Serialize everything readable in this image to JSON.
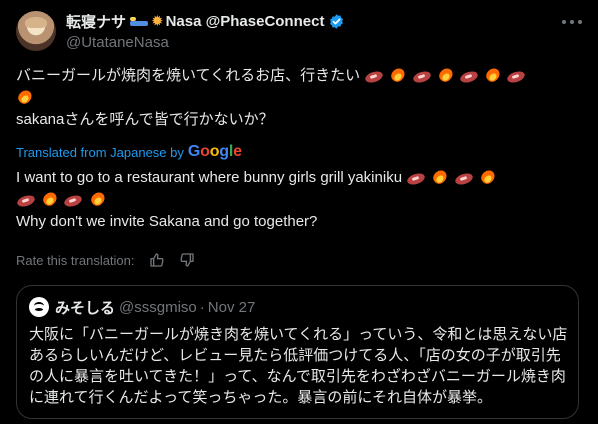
{
  "author": {
    "display_name": "転寝ナサ",
    "display_name_suffix": "Nasa @PhaseConnect",
    "handle": "@UtataneNasa",
    "icons": [
      "bed-icon",
      "sun-icon",
      "verified-icon"
    ],
    "verified_color": "#1d9bf0"
  },
  "tweet": {
    "line1": "バニーガールが焼肉を焼いてくれるお店、行きたい",
    "line1_emojis": [
      "meat-icon",
      "fire-icon",
      "meat-icon",
      "fire-icon",
      "meat-icon",
      "fire-icon",
      "meat-icon"
    ],
    "line2_emojis": [
      "fire-icon"
    ],
    "line3": "sakanaさんを呼んで皆で行かないか？"
  },
  "translation_notice": {
    "label": "Translated from Japanese by",
    "provider": "Google",
    "provider_letters": [
      "G",
      "o",
      "o",
      "g",
      "l",
      "e"
    ],
    "accent": "#1d9bf0"
  },
  "translation": {
    "line1": "I want to go to a restaurant where bunny girls grill yakiniku",
    "line1_emojis": [
      "meat-icon",
      "fire-icon",
      "meat-icon",
      "fire-icon"
    ],
    "line2_emojis": [
      "meat-icon",
      "fire-icon",
      "meat-icon",
      "fire-icon"
    ],
    "line3": "Why don't we invite Sakana and go together?"
  },
  "rate": {
    "label": "Rate this translation:",
    "icons": [
      "thumbs-up-icon",
      "thumbs-down-icon"
    ]
  },
  "quote": {
    "name": "みそしる",
    "handle": "@sssgmiso",
    "separator": "·",
    "date": "Nov 27",
    "lines": [
      "大阪に「バニーガールが焼き肉を焼いてくれる」っていう、令和とは思えない店",
      "あるらしいんだけど、レビュー見たら低評価つけてる人、「店の女の子が取引先",
      "の人に暴言を吐いてきた！」って、なんで取引先をわざわざバニーガール焼き肉",
      "に連れて行くんだよって笑っちゃった。暴言の前にそれ自体が暴挙。"
    ]
  }
}
